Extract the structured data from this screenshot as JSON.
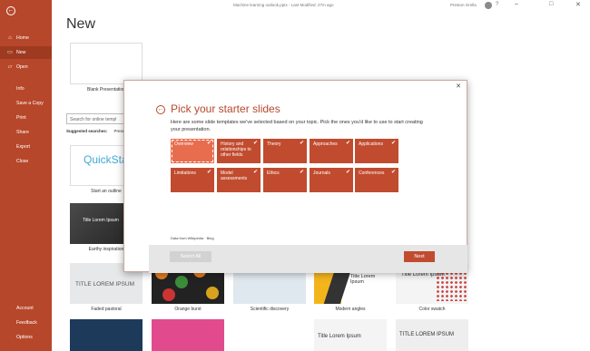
{
  "titlebar": {
    "doc_title": "Machine learning outlook.pptx  -  Last Modified: 27m ago",
    "user_name": "Preston Grella",
    "help": "?",
    "minimize": "–",
    "maximize": "□",
    "close": "✕"
  },
  "sidebar": {
    "back": "←",
    "items": [
      {
        "label": "Home",
        "icon": "⌂"
      },
      {
        "label": "New",
        "icon": "▭"
      },
      {
        "label": "Open",
        "icon": "▱"
      },
      {
        "label": "Info"
      },
      {
        "label": "Save a Copy"
      },
      {
        "label": "Print"
      },
      {
        "label": "Share"
      },
      {
        "label": "Export"
      },
      {
        "label": "Close"
      },
      {
        "label": "Account"
      },
      {
        "label": "Feedback"
      },
      {
        "label": "Options"
      }
    ]
  },
  "page": {
    "heading": "New",
    "blank_label": "Blank Presentation",
    "search_placeholder": "Search for online templ",
    "suggested_label": "Suggested searches:",
    "suggested_item": "Prese"
  },
  "templates": {
    "quickstart_text": "QuickStart",
    "start_outline": "Start an outline",
    "earthy_title": "Title Lorem Ipsum",
    "earthy": "Earthy inspiration",
    "faded_title": "TITLE LOREM IPSUM",
    "faded": "Faded pastoral",
    "orange": "Orange burst",
    "scientific": "Scientific discovery",
    "modern_title": "Title Lorem Ipsum",
    "modern": "Modern angles",
    "swatch_title": "Title Lorem Ipsum",
    "swatch": "Color swatch",
    "row4_c": "Title Lorem Ipsum",
    "row4_d": "TITLE LOREM IPSUM"
  },
  "dialog": {
    "close": "✕",
    "back": "←",
    "title": "Pick your starter slides",
    "description": "Here are some slide templates we've selected based on your topic. Pick the ones you'd like to use to start creating your presentation.",
    "check": "✔",
    "tiles": [
      {
        "label": "Overview",
        "highlight": true
      },
      {
        "label": "History and relationships to other fields"
      },
      {
        "label": "Theory"
      },
      {
        "label": "Approaches"
      },
      {
        "label": "Applications"
      },
      {
        "label": "Limitations"
      },
      {
        "label": "Model assessments"
      },
      {
        "label": "Ethics"
      },
      {
        "label": "Journals"
      },
      {
        "label": "Conferences"
      }
    ],
    "source": "Data from Wikipedia · Bing",
    "select_all": "Select All",
    "next": "Next"
  },
  "colors": {
    "accent": "#b7472a",
    "tile": "#c14b2e",
    "tile_highlight": "#e86d4f"
  }
}
